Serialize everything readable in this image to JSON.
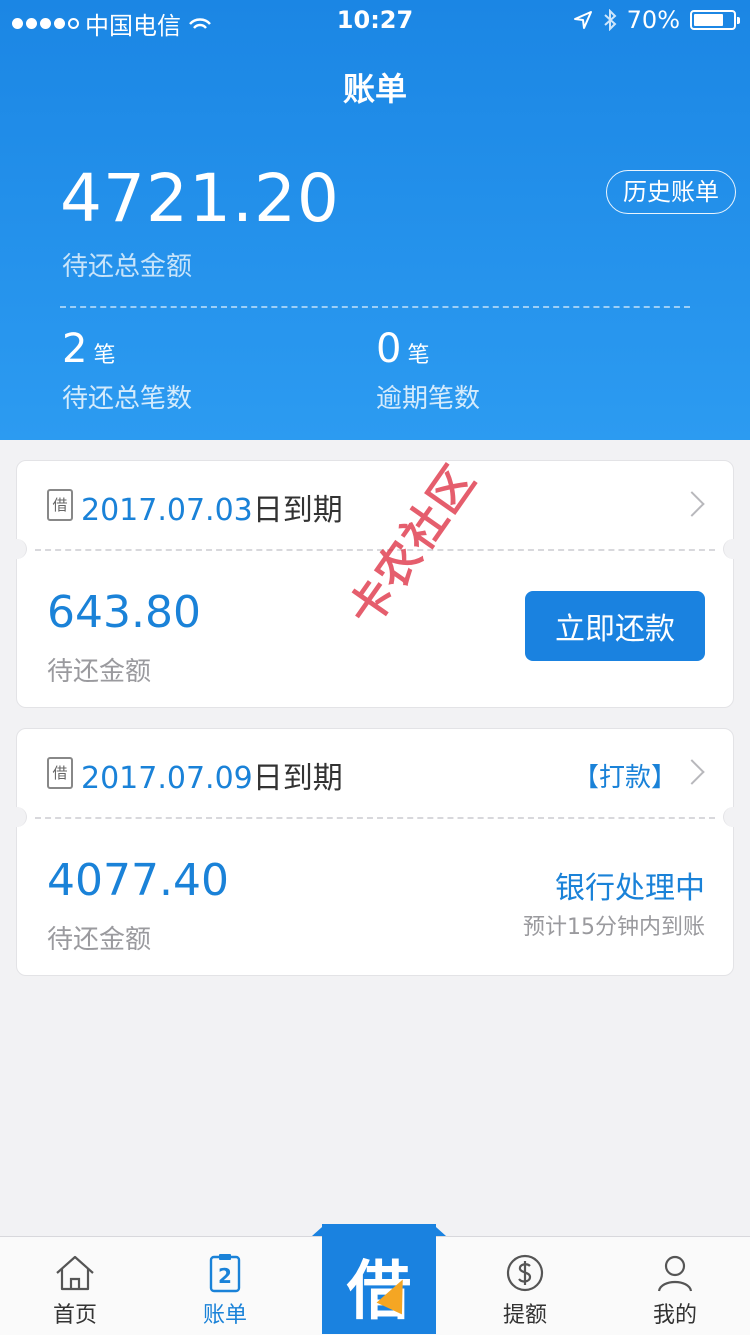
{
  "status_bar": {
    "carrier": "中国电信",
    "time": "10:27",
    "battery": "70%",
    "battery_level": 0.7
  },
  "header": {
    "title": "账单",
    "total_amount": "4721.20",
    "total_label": "待还总金额",
    "history_button": "历史账单",
    "stats": [
      {
        "value": "2",
        "unit": "笔",
        "label": "待还总笔数"
      },
      {
        "value": "0",
        "unit": "笔",
        "label": "逾期笔数"
      }
    ]
  },
  "bills": [
    {
      "due_date": "2017.07.03",
      "due_suffix": "日到期",
      "amount": "643.80",
      "amount_label": "待还金额",
      "action_label": "立即还款"
    },
    {
      "due_date": "2017.07.09",
      "due_suffix": "日到期",
      "tag": "【打款】",
      "amount": "4077.40",
      "amount_label": "待还金额",
      "status": "银行处理中",
      "status_note": "预计15分钟内到账"
    }
  ],
  "bill_icon_char": "借",
  "watermark": "卡农社区",
  "tabbar": {
    "items": [
      {
        "label": "首页",
        "icon": "home-icon"
      },
      {
        "label": "账单",
        "icon": "bill-icon",
        "badge": "2"
      },
      {
        "label": "借",
        "icon": "borrow-icon"
      },
      {
        "label": "提额",
        "icon": "dollar-icon"
      },
      {
        "label": "我的",
        "icon": "user-icon"
      }
    ],
    "active_index": 1
  },
  "colors": {
    "primary": "#1a82e0",
    "header_gradient_top": "#1b86e4",
    "header_gradient_bottom": "#2c9bf1",
    "accent_bolt": "#f5a623",
    "background": "#f2f2f4"
  }
}
